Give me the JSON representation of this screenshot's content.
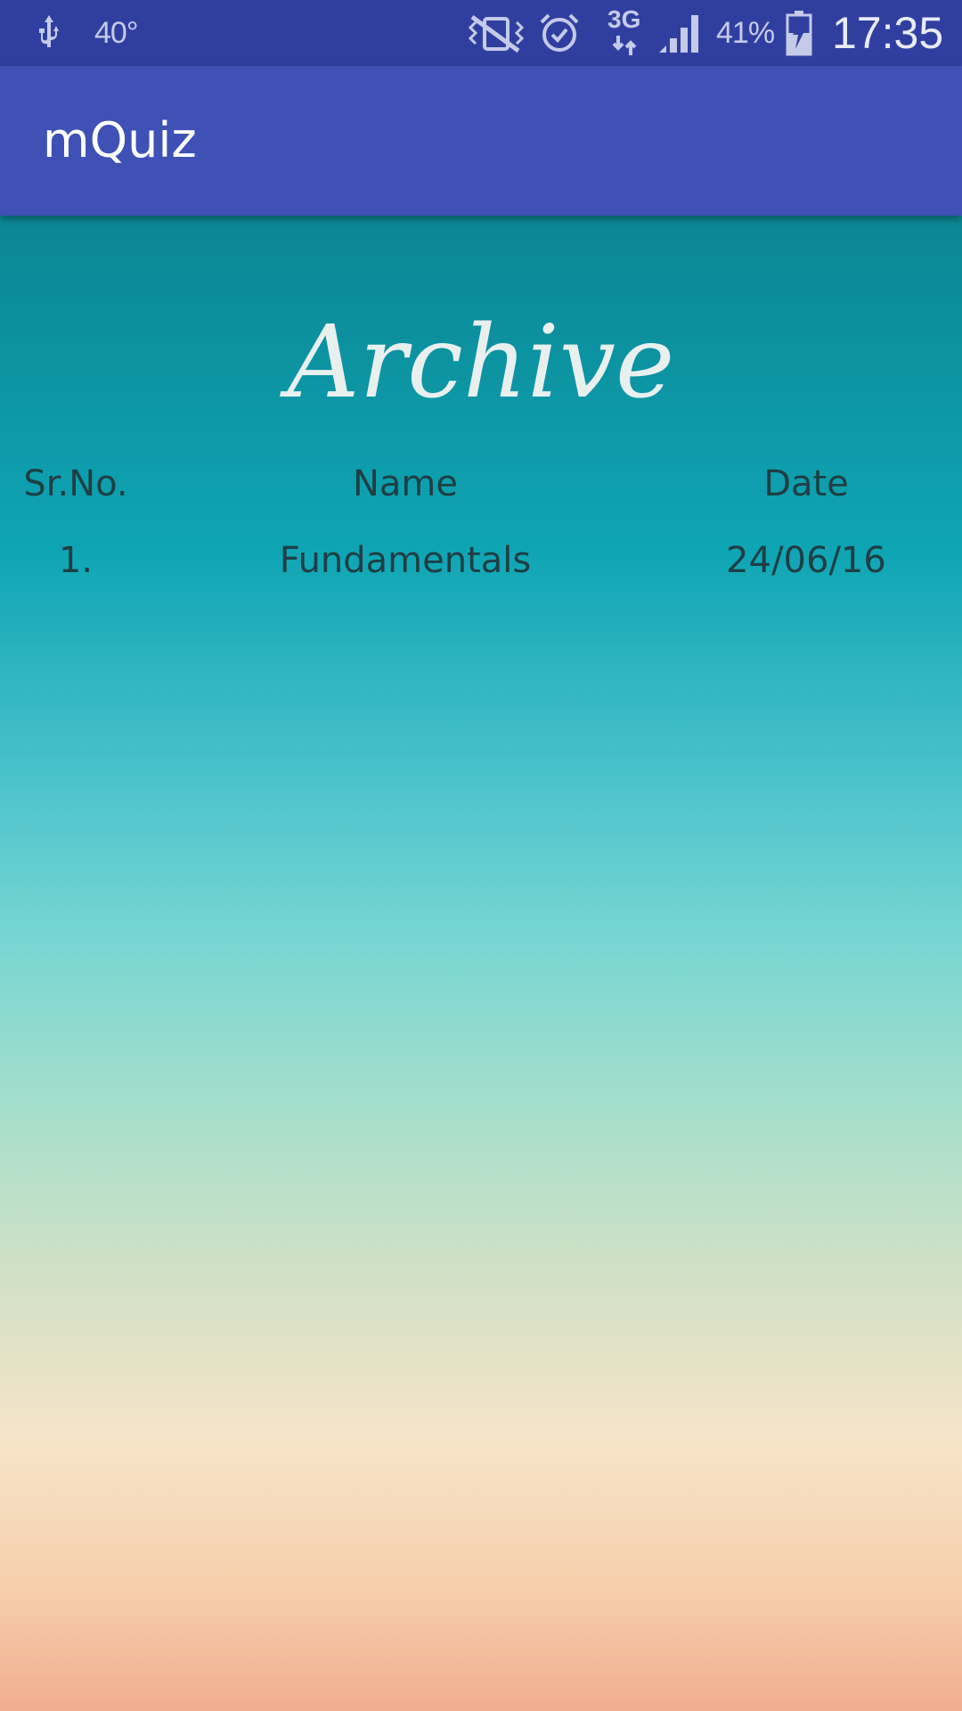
{
  "status_bar": {
    "temperature": "40°",
    "network": "3G",
    "battery": "41%",
    "time": "17:35",
    "icons": [
      "usb-icon",
      "vibrate-off-icon",
      "alarm-icon",
      "network-3g-icon",
      "signal-icon",
      "battery-charging-icon"
    ]
  },
  "app_bar": {
    "title": "mQuiz"
  },
  "page": {
    "heading": "Archive"
  },
  "table": {
    "headers": {
      "sr": "Sr.No.",
      "name": "Name",
      "date": "Date"
    },
    "rows": [
      {
        "sr": "1.",
        "name": "Fundamentals",
        "date": "24/06/16"
      }
    ]
  },
  "colors": {
    "status_bar": "#303f9f",
    "app_bar": "#3f51b5",
    "table_text": "#1e3f44"
  }
}
